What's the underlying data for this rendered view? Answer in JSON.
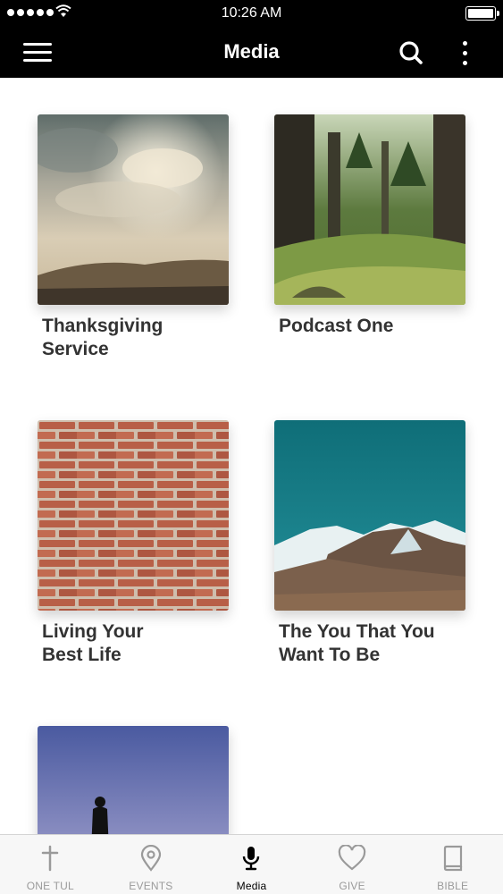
{
  "status_bar": {
    "time": "10:26 AM"
  },
  "nav": {
    "title": "Media"
  },
  "media_items": [
    {
      "title": "Thanksgiving\nService",
      "image": "sky-clouds-hills"
    },
    {
      "title": "Podcast One",
      "image": "forest-path"
    },
    {
      "title": "Living Your\nBest Life",
      "image": "red-brick-wall"
    },
    {
      "title": "The You That You\nWant To Be",
      "image": "snowy-mountains"
    },
    {
      "title": "",
      "image": "silhouette-person-sky"
    }
  ],
  "tabs": [
    {
      "label": "ONE TUL",
      "icon": "cross-icon",
      "active": false
    },
    {
      "label": "EVENTS",
      "icon": "location-pin-icon",
      "active": false
    },
    {
      "label": "Media",
      "icon": "microphone-icon",
      "active": true
    },
    {
      "label": "GIVE",
      "icon": "heart-icon",
      "active": false
    },
    {
      "label": "BIBLE",
      "icon": "book-icon",
      "active": false
    }
  ],
  "colors": {
    "bar_background": "#000000",
    "tab_active": "#000000",
    "tab_inactive": "#9a9a9a",
    "title_text": "#333333"
  }
}
